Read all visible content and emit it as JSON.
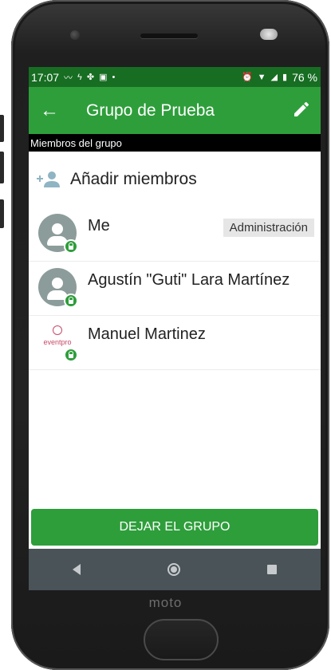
{
  "status_bar": {
    "time": "17:07",
    "battery_percent": "76 %",
    "left_icons": [
      "activity-icon",
      "flash-icon",
      "fan-icon",
      "image-icon",
      "dot-icon"
    ],
    "right_icons": [
      "alarm-icon",
      "wifi-icon",
      "signal-icon",
      "battery-icon"
    ]
  },
  "app_bar": {
    "title": "Grupo de Prueba",
    "back_icon": "arrow-left-icon",
    "edit_icon": "pencil-icon"
  },
  "section_header": "Miembros del grupo",
  "add_members_label": "Añadir miembros",
  "members": [
    {
      "name": "Me",
      "badge": "Administración",
      "avatar": "default-user-avatar"
    },
    {
      "name": "Agustín \"Guti\" Lara Martínez",
      "badge": "",
      "avatar": "default-user-avatar"
    },
    {
      "name": "Manuel Martinez",
      "badge": "",
      "avatar": "eventpro-logo"
    }
  ],
  "logo_word": "eventpro",
  "leave_button_label": "DEJAR EL GRUPO",
  "device_brand": "moto",
  "colors": {
    "accent": "#2e9e3b",
    "status_bar": "#176d22",
    "nav_bar": "#4a5358"
  }
}
